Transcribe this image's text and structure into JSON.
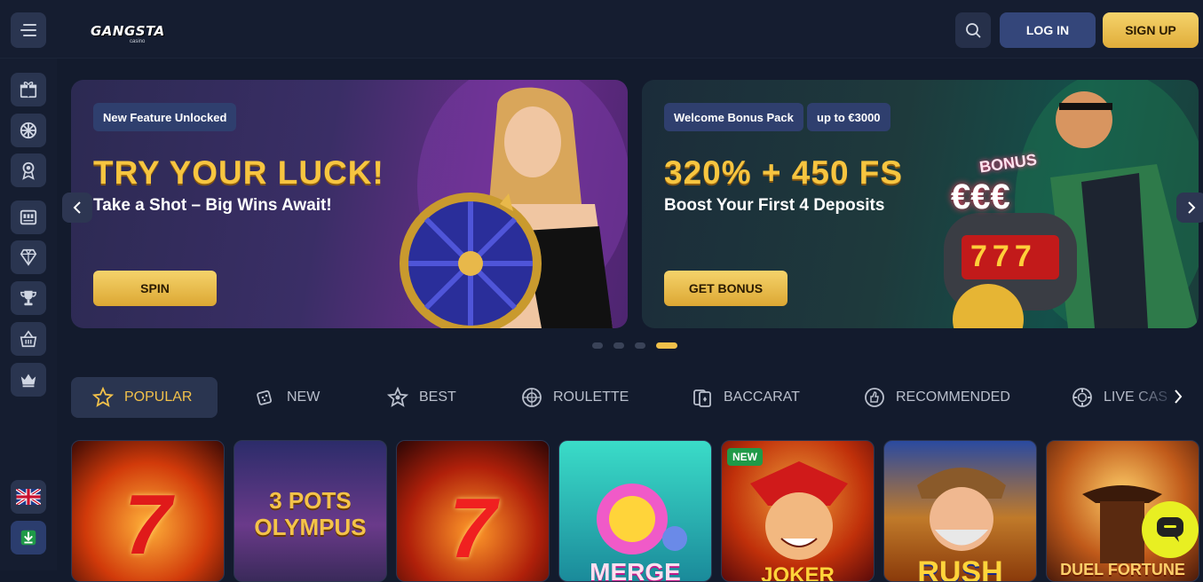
{
  "header": {
    "logo_text": "GANGSTA",
    "logo_sub": "casino",
    "login_label": "LOG IN",
    "signup_label": "SIGN UP"
  },
  "sidebar": {
    "items": [
      "gift-icon",
      "wheel-icon",
      "award-icon",
      "slot-machine-icon",
      "diamond-ring-icon",
      "trophy-icon",
      "shop-basket-icon",
      "crown-icon"
    ],
    "language": "uk-flag-icon",
    "download": "download-icon"
  },
  "banners": [
    {
      "tags": [
        "New Feature Unlocked"
      ],
      "headline": "TRY YOUR LUCK!",
      "subline": "Take a Shot – Big Wins Await!",
      "cta": "SPIN"
    },
    {
      "tags": [
        "Welcome Bonus Pack",
        "up to €3000"
      ],
      "headline": "320% + 450 FS",
      "subline": "Boost Your First 4 Deposits",
      "cta": "GET BONUS",
      "art_text": "€€€",
      "art_bonus": "BONUS",
      "art_reels": "777"
    }
  ],
  "carousel": {
    "slides": 4,
    "active_slide": 4
  },
  "tabs": [
    {
      "label": "POPULAR",
      "icon": "star-icon",
      "active": true
    },
    {
      "label": "NEW",
      "icon": "dice-icon",
      "active": false
    },
    {
      "label": "BEST",
      "icon": "star-badge-icon",
      "active": false
    },
    {
      "label": "ROULETTE",
      "icon": "roulette-icon",
      "active": false
    },
    {
      "label": "BACCARAT",
      "icon": "cards-icon",
      "active": false
    },
    {
      "label": "RECOMMENDED",
      "icon": "thumbs-up-icon",
      "active": false
    },
    {
      "label": "LIVE CAS",
      "icon": "chip-icon",
      "active": false
    }
  ],
  "games": [
    {
      "title": "7",
      "badge": ""
    },
    {
      "title": "3 POTS OLYMPUS",
      "badge": ""
    },
    {
      "title": "7",
      "badge": ""
    },
    {
      "title": "MERGE",
      "badge": ""
    },
    {
      "title": "JOKER",
      "badge": "NEW"
    },
    {
      "title": "RUSH",
      "badge": ""
    },
    {
      "title": "DUEL FORTUNE",
      "badge": ""
    }
  ],
  "colors": {
    "accent": "#f2c14a",
    "bg": "#131b2d",
    "surface": "#2a3550",
    "login": "#34467a"
  }
}
